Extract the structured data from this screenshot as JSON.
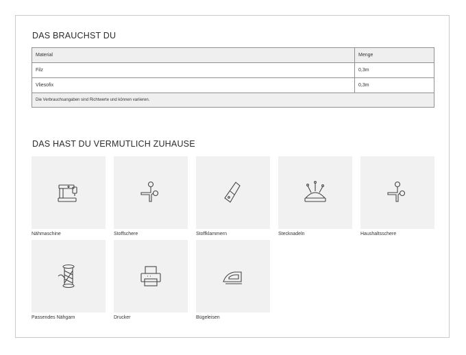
{
  "sections": {
    "needed_title": "DAS BRAUCHST DU",
    "home_title": "DAS HAST DU VERMUTLICH ZUHAUSE"
  },
  "materials": {
    "headers": {
      "material": "Material",
      "quantity": "Menge"
    },
    "rows": [
      {
        "material": "Filz",
        "quantity": "0,3m"
      },
      {
        "material": "Vliesofix",
        "quantity": "0,3m"
      }
    ],
    "note": "Die Verbrauchsangaben sind Richtwerte und können variieren."
  },
  "tools": [
    {
      "label": "Nähmaschine",
      "icon": "sewing-machine-icon"
    },
    {
      "label": "Stoffschere",
      "icon": "scissors-icon"
    },
    {
      "label": "Stoffklammern",
      "icon": "fabric-clip-icon"
    },
    {
      "label": "Stecknadeln",
      "icon": "pincushion-icon"
    },
    {
      "label": "Haushaltsschere",
      "icon": "scissors-icon"
    },
    {
      "label": "Passendes Nähgarn",
      "icon": "thread-spool-icon"
    },
    {
      "label": "Drucker",
      "icon": "printer-icon"
    },
    {
      "label": "Bügeleisen",
      "icon": "iron-icon"
    }
  ],
  "colors": {
    "tile_bg": "#f1f1f1",
    "table_header_bg": "#efefef",
    "border": "#c9c9c9"
  }
}
